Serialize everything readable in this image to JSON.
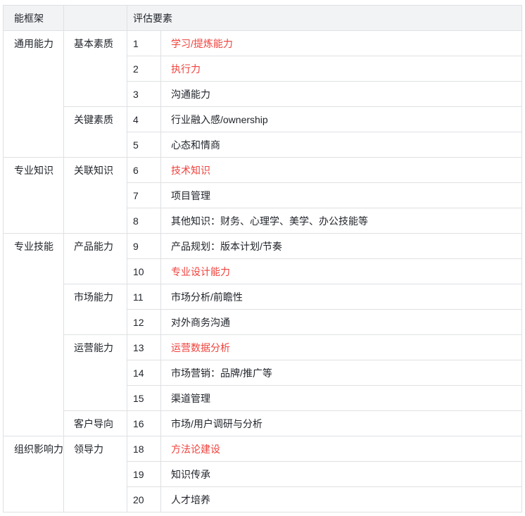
{
  "header": {
    "framework_label": "能框架",
    "blank_label": "",
    "elements_label": "评估要素"
  },
  "colors": {
    "accent_red": "#ef423c",
    "text": "#1f2329",
    "border": "#dee0e3",
    "header_background": "#f2f3f5"
  },
  "table": {
    "groups": [
      {
        "name": "通用能力",
        "subgroups": [
          {
            "name": "基本素质",
            "items": [
              {
                "no": "1",
                "label": "学习/提炼能力",
                "highlight": true
              },
              {
                "no": "2",
                "label": "执行力",
                "highlight": true
              },
              {
                "no": "3",
                "label": "沟通能力",
                "highlight": false
              }
            ]
          },
          {
            "name": "关键素质",
            "items": [
              {
                "no": "4",
                "label": "行业融入感/ownership",
                "highlight": false
              },
              {
                "no": "5",
                "label": "心态和情商",
                "highlight": false
              }
            ]
          }
        ]
      },
      {
        "name": "专业知识",
        "subgroups": [
          {
            "name": "关联知识",
            "items": [
              {
                "no": "6",
                "label": "技术知识",
                "highlight": true
              },
              {
                "no": "7",
                "label": "项目管理",
                "highlight": false
              },
              {
                "no": "8",
                "label": "其他知识：财务、心理学、美学、办公技能等",
                "highlight": false
              }
            ]
          }
        ]
      },
      {
        "name": "专业技能",
        "subgroups": [
          {
            "name": "产品能力",
            "items": [
              {
                "no": "9",
                "label": "产品规划：版本计划/节奏",
                "highlight": false
              },
              {
                "no": "10",
                "label": "专业设计能力",
                "highlight": true
              }
            ]
          },
          {
            "name": "市场能力",
            "items": [
              {
                "no": "11",
                "label": "市场分析/前瞻性",
                "highlight": false
              },
              {
                "no": "12",
                "label": "对外商务沟通",
                "highlight": false
              }
            ]
          },
          {
            "name": "运营能力",
            "items": [
              {
                "no": "13",
                "label": "运营数据分析",
                "highlight": true
              },
              {
                "no": "14",
                "label": "市场营销：品牌/推广等",
                "highlight": false
              },
              {
                "no": "15",
                "label": "渠道管理",
                "highlight": false
              }
            ]
          },
          {
            "name": "客户导向",
            "items": [
              {
                "no": "16",
                "label": "市场/用户调研与分析",
                "highlight": false
              }
            ]
          }
        ]
      },
      {
        "name": "组织影响力",
        "subgroups": [
          {
            "name": "领导力",
            "items": [
              {
                "no": "18",
                "label": "方法论建设",
                "highlight": true
              },
              {
                "no": "19",
                "label": "知识传承",
                "highlight": false
              },
              {
                "no": "20",
                "label": "人才培养",
                "highlight": false
              }
            ]
          }
        ]
      }
    ]
  }
}
